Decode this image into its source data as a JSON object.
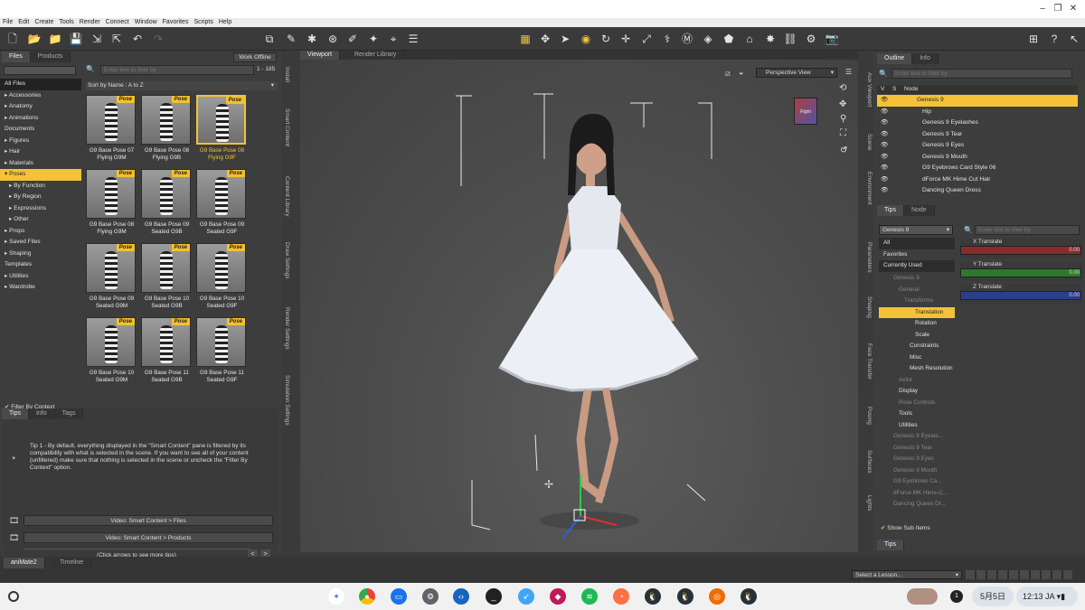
{
  "menubar": [
    "File",
    "Edit",
    "Create",
    "Tools",
    "Render",
    "Connect",
    "Window",
    "Favorites",
    "Scripts",
    "Help"
  ],
  "left": {
    "tabs": [
      "Files",
      "Products"
    ],
    "work_offline": "Work Offline",
    "filter_placeholder": "Enter text to filter by",
    "count": "1 - 185",
    "sort": "Sort by Name : A to Z",
    "tree": [
      {
        "label": "All Files"
      },
      {
        "label": "▸ Accessories"
      },
      {
        "label": "▸ Anatomy"
      },
      {
        "label": "▸ Animations"
      },
      {
        "label": "Documents"
      },
      {
        "label": "▸ Figures"
      },
      {
        "label": "▸ Hair"
      },
      {
        "label": "▸ Materials"
      },
      {
        "label": "▾ Poses"
      },
      {
        "label": "▸ By Function"
      },
      {
        "label": "▸ By Region"
      },
      {
        "label": "▸ Expressions"
      },
      {
        "label": "▸ Other"
      },
      {
        "label": "▸ Props"
      },
      {
        "label": "▸ Saved Files"
      },
      {
        "label": "▸ Shaping"
      },
      {
        "label": "Templates"
      },
      {
        "label": "▸ Utilities"
      },
      {
        "label": "▸ Wardrobe"
      }
    ],
    "filter_by_context": "Filter By Context",
    "badge": "Pose",
    "thumbs": [
      {
        "cap": "G9 Base Pose 07 Flying G9M"
      },
      {
        "cap": "G9 Base Pose 08 Flying G9B"
      },
      {
        "cap": "G9 Base Pose 08 Flying G9F"
      },
      {
        "cap": "G9 Base Pose 08 Flying G9M"
      },
      {
        "cap": "G9 Base Pose 09 Seated G9B"
      },
      {
        "cap": "G9 Base Pose 09 Seated G9F"
      },
      {
        "cap": "G9 Base Pose 09 Seated G9M"
      },
      {
        "cap": "G9 Base Pose 10 Seated G9B"
      },
      {
        "cap": "G9 Base Pose 10 Seated G9F"
      },
      {
        "cap": "G9 Base Pose 10 Seated G9M"
      },
      {
        "cap": "G9 Base Pose 11 Seated G9B"
      },
      {
        "cap": "G9 Base Pose 11 Seated G9F"
      }
    ],
    "tips_tabs": [
      "Tips",
      "Info",
      "Tags"
    ],
    "tip_text": "Tip 1 - By default, everything displayed in the \"Smart Content\" pane is filtered by its compatibility with what is selected in the scene. If you want to see all of your content (unfiltered) make sure that nothing is selected in the scene or uncheck the \"Filter By Context\" option.",
    "click_arrows": "(Click arrows to see more tips)",
    "video1": "Video: Smart Content > Files",
    "video2": "Video: Smart Content > Products",
    "side_tabs": [
      "Install",
      "Smart Content",
      "Content Library",
      "Draw Settings",
      "Render Settings",
      "Simulation Settings"
    ]
  },
  "viewport": {
    "tabs": [
      "Viewport",
      "Render Library"
    ],
    "camera": "Perspective View",
    "cube_label": "Right"
  },
  "right": {
    "tabs": [
      "Outline",
      "Info"
    ],
    "filter_placeholder": "Enter text to filter by",
    "header": [
      "V",
      "S",
      "Node"
    ],
    "nodes": [
      {
        "label": "Genesis 9"
      },
      {
        "label": "Hip"
      },
      {
        "label": "Genesis 9 Eyelashes"
      },
      {
        "label": "Genesis 9 Tear"
      },
      {
        "label": "Genesis 9 Eyes"
      },
      {
        "label": "Genesis 9 Mouth"
      },
      {
        "label": "G9 Eyebrows Card Style 06"
      },
      {
        "label": "dForce MK Hime Cut Hair"
      },
      {
        "label": "Dancing Queen Dress"
      }
    ],
    "side_tabs_top": [
      "Aux Viewport",
      "Scene",
      "Environment"
    ],
    "side_tabs_bottom": [
      "Parameters",
      "Shaping",
      "Face Transfer",
      "Posing",
      "Surfaces",
      "Lights"
    ],
    "tips_tabs": [
      "Tips",
      "Node"
    ],
    "figure_select": "Genesis 9",
    "param_filter_placeholder": "Enter text to filter by",
    "groups": [
      "All",
      "Favorites",
      "Currently Used"
    ],
    "params": [
      {
        "label": "Genesis 9"
      },
      {
        "label": "General"
      },
      {
        "label": "Transforms"
      },
      {
        "label": "Translation"
      },
      {
        "label": "Rotation"
      },
      {
        "label": "Scale"
      },
      {
        "label": "Constraints"
      },
      {
        "label": "Misc"
      },
      {
        "label": "Mesh Resolution"
      },
      {
        "label": "Actor"
      },
      {
        "label": "Display"
      },
      {
        "label": "Pose Controls"
      },
      {
        "label": "Tools"
      },
      {
        "label": "Utilities"
      },
      {
        "label": "Genesis 9 Eyelas..."
      },
      {
        "label": "Genesis 9 Tear"
      },
      {
        "label": "Genesis 9 Eyes"
      },
      {
        "label": "Genesis 9 Mouth"
      },
      {
        "label": "G9 Eyebrows Ca..."
      },
      {
        "label": "dForce MK Hime-C..."
      },
      {
        "label": "Dancing Queen Dr..."
      }
    ],
    "sliders": [
      {
        "label": "X Translate",
        "value": "0.00",
        "color": "#8a2b2b"
      },
      {
        "label": "Y Translate",
        "value": "0.00",
        "color": "#2b7a2b"
      },
      {
        "label": "Z Translate",
        "value": "0.00",
        "color": "#2b3f8a"
      }
    ],
    "show_sub": "Show Sub Items",
    "tips": "Tips"
  },
  "bottom": {
    "tabs": [
      "aniMate2",
      "Timeline"
    ],
    "lesson": "Select a Lesson..."
  },
  "taskbar": {
    "date": "5月5日",
    "time": "12:13",
    "ime": "JA",
    "notif": "1"
  }
}
